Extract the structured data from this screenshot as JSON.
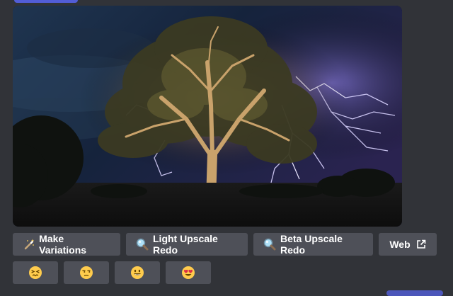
{
  "message": {
    "image": {
      "icon": "generated-image-lightning-tree"
    },
    "actions": [
      {
        "label": "Make Variations",
        "icon": "magic-wand-icon"
      },
      {
        "label": "Light Upscale Redo",
        "icon": "magnifier-icon"
      },
      {
        "label": "Beta Upscale Redo",
        "icon": "magnifier-icon"
      },
      {
        "label": "Web",
        "icon": "external-link-icon"
      }
    ],
    "reactions": [
      {
        "icon": "confounded-face-emoji"
      },
      {
        "icon": "unamused-face-emoji"
      },
      {
        "icon": "grinning-face-emoji"
      },
      {
        "icon": "heart-eyes-face-emoji"
      }
    ]
  },
  "colors": {
    "background": "#313338",
    "button": "#4e5058",
    "button_text": "#ffffff",
    "accent": "#5865f2"
  }
}
